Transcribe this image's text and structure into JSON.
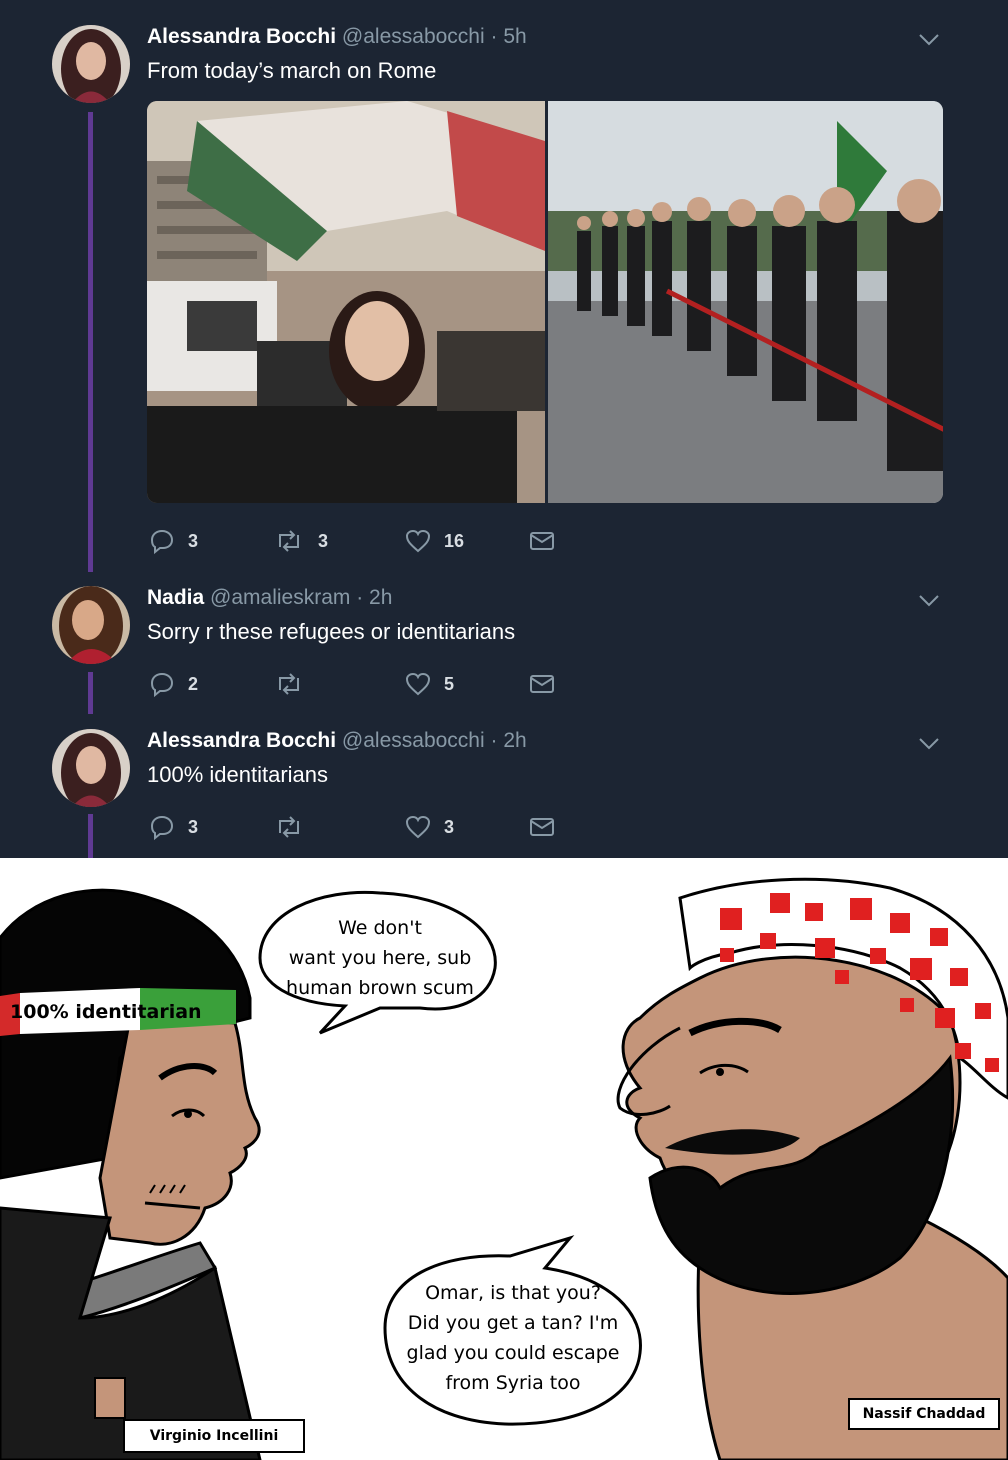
{
  "thread": {
    "tweets": [
      {
        "name": "Alessandra Bocchi",
        "handle": "@alessabocchi",
        "time": "· 5h",
        "text": "From today’s march on Rome",
        "replies": "3",
        "retweets": "3",
        "likes": "16"
      },
      {
        "name": "Nadia",
        "handle": "@amalieskram",
        "time": "· 2h",
        "text": "Sorry r these refugees or identitarians",
        "replies": "2",
        "retweets": "",
        "likes": "5"
      },
      {
        "name": "Alessandra Bocchi",
        "handle": "@alessabocchi",
        "time": "· 2h",
        "text": "100% identitarians",
        "replies": "3",
        "retweets": "",
        "likes": "3"
      }
    ],
    "icons": [
      "reply-icon",
      "retweet-icon",
      "like-icon",
      "direct-message-icon",
      "chevron-down-icon"
    ],
    "colors": {
      "background": "#1c2533",
      "thread_line": "#5f3a93",
      "muted": "#8899a6"
    }
  },
  "comic": {
    "left_bubble": [
      "We don't",
      "want you here, sub",
      "human brown scum"
    ],
    "right_bubble": [
      "Omar, is that you?",
      "Did you get a tan? I'm",
      "glad you could escape",
      "from Syria too"
    ],
    "headband": "100% identitarian",
    "left_name": "Virginio Incellini",
    "right_name": "Nassif Chaddad"
  }
}
